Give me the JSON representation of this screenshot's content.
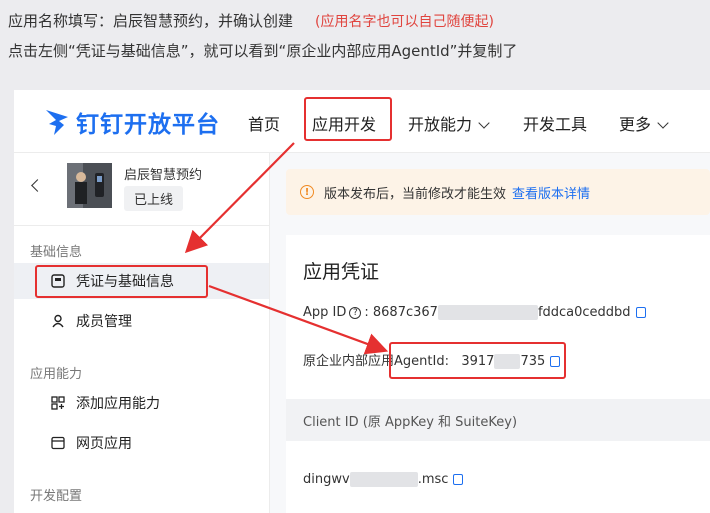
{
  "instructions": {
    "line1": "应用名称填写：启辰智慧预约，并确认创建",
    "note": "(应用名字也可以自己随便起)",
    "line2": "点击左侧“凭证与基础信息”，就可以看到“原企业内部应用AgentId”并复制了"
  },
  "brand": {
    "name": "钉钉开放平台",
    "color": "#1d6ff0"
  },
  "nav": {
    "home": "首页",
    "app_dev": "应用开发",
    "open_ability": "开放能力",
    "dev_tools": "开发工具",
    "more": "更多"
  },
  "app": {
    "name": "启辰智慧预约",
    "status": "已上线"
  },
  "sidebar": {
    "group_basic": "基础信息",
    "credentials": "凭证与基础信息",
    "members": "成员管理",
    "group_ability": "应用能力",
    "add_ability": "添加应用能力",
    "web_app": "网页应用",
    "group_dev": "开发配置"
  },
  "notice": {
    "text": "版本发布后，当前修改才能生效",
    "link": "查看版本详情"
  },
  "credentials": {
    "title": "应用凭证",
    "app_id_label": "App ID",
    "app_id_prefix": "8687c367",
    "app_id_suffix": "fddca0ceddbd",
    "agent_label": "原企业内部应用AgentId:",
    "agent_prefix": "3917",
    "agent_suffix": "735",
    "client_header": "Client ID (原 AppKey 和 SuiteKey)",
    "client_prefix": "dingwv",
    "client_suffix": ".msc"
  },
  "colors": {
    "annotation": "#e53030",
    "accent": "#1d6ff0",
    "warning": "#f08a24"
  }
}
